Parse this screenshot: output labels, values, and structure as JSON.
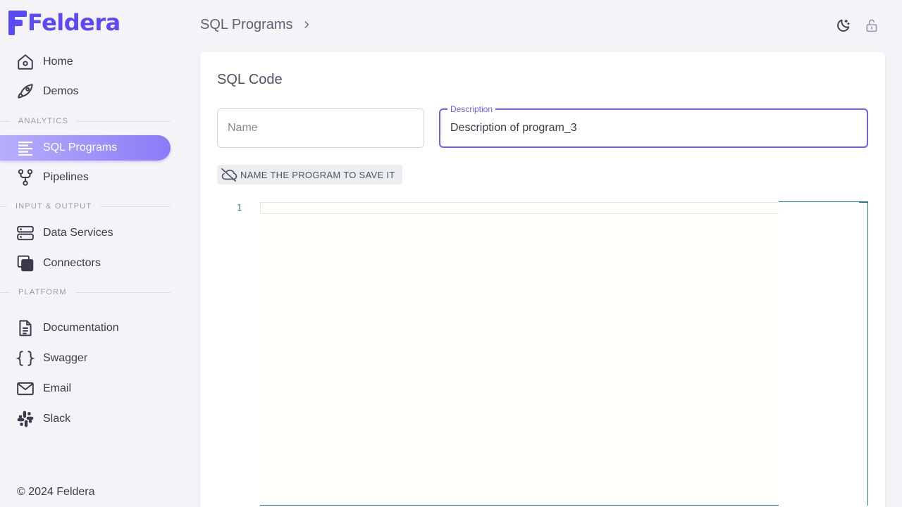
{
  "brand": {
    "name": "Feldera",
    "color": "#5b49f5"
  },
  "sidebar": {
    "top_items": [
      {
        "label": "Home",
        "icon": "home-icon"
      },
      {
        "label": "Demos",
        "icon": "rocket-icon"
      }
    ],
    "sections": [
      {
        "title": "Analytics",
        "items": [
          {
            "label": "SQL Programs",
            "icon": "list-lines-icon",
            "active": true
          },
          {
            "label": "Pipelines",
            "icon": "branch-icon"
          }
        ]
      },
      {
        "title": "Input & Output",
        "items": [
          {
            "label": "Data Services",
            "icon": "server-icon"
          },
          {
            "label": "Connectors",
            "icon": "stacked-squares-icon"
          }
        ]
      },
      {
        "title": "Platform",
        "items": [
          {
            "label": "Documentation",
            "icon": "document-icon"
          },
          {
            "label": "Swagger",
            "icon": "braces-icon"
          },
          {
            "label": "Email",
            "icon": "envelope-icon"
          },
          {
            "label": "Slack",
            "icon": "slack-icon"
          }
        ]
      }
    ],
    "footer": "© 2024 Feldera"
  },
  "header": {
    "breadcrumb": "SQL Programs",
    "icons": [
      "theme-toggle-icon",
      "unlock-icon"
    ]
  },
  "main": {
    "title": "SQL Code",
    "name_field": {
      "placeholder": "Name",
      "value": ""
    },
    "description_field": {
      "label": "Description",
      "value": "Description of program_3"
    },
    "save_status": "Name the program to save it",
    "editor": {
      "line_numbers": [
        "1"
      ]
    }
  }
}
